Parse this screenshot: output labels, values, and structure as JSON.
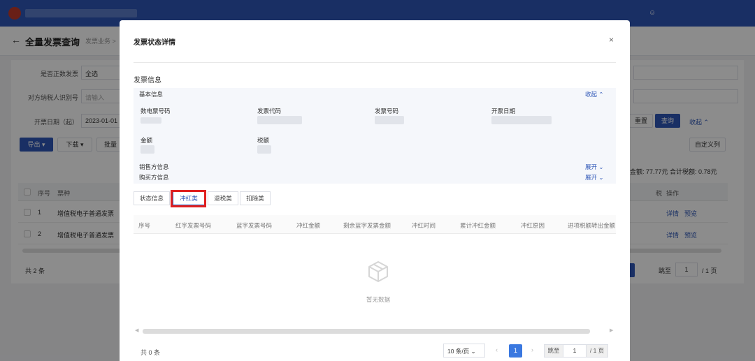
{
  "background": {
    "page_title": "全量发票查询",
    "breadcrumb": "发票业务 >",
    "filters": {
      "is_normal_label": "是否正数发票",
      "is_normal_value": "全选",
      "counterparty_label": "对方纳税人识别号",
      "counterparty_placeholder": "请输入",
      "date_label": "开票日期（起）",
      "date_value": "2023-01-01"
    },
    "buttons": {
      "export": "导出 ▾",
      "download": "下载 ▾",
      "batch": "批量",
      "reset": "重置",
      "query": "查询",
      "collapse": "收起 ⌃",
      "custom_columns": "自定义列"
    },
    "summary": "金额: 77.77元   合计税额: 0.78元",
    "table_headers": [
      "序号",
      "票种",
      "税",
      "操作"
    ],
    "rows": [
      {
        "index": "1",
        "type": "增值税电子普通发票",
        "action1": "详情",
        "action2": "预览"
      },
      {
        "index": "2",
        "type": "增值税电子普通发票",
        "action1": "详情",
        "action2": "预览"
      }
    ],
    "total": "共 2 条",
    "pager": {
      "jump_label": "跳至",
      "jump_value": "1",
      "total_pages": "/ 1 页"
    }
  },
  "modal": {
    "title": "发票状态详情",
    "close": "×",
    "section_title": "发票信息",
    "basic_info": {
      "heading": "基本信息",
      "collapse": "收起 ⌃",
      "labels": {
        "digital_number": "数电票号码",
        "invoice_code": "发票代码",
        "invoice_number": "发票号码",
        "issue_date": "开票日期",
        "amount": "金额",
        "tax": "税额"
      },
      "seller_heading": "销售方信息",
      "seller_expand": "展开 ⌄",
      "buyer_heading": "购买方信息",
      "buyer_expand": "展开 ⌄"
    },
    "tabs": [
      "状态信息",
      "冲红类",
      "退税类",
      "扣除类"
    ],
    "active_tab": 1,
    "table_headers": [
      "序号",
      "红字发票号码",
      "蓝字发票号码",
      "冲红金额",
      "剩余蓝字发票金额",
      "冲红时间",
      "累计冲红金额",
      "冲红原因",
      "进项税额转出金额"
    ],
    "empty_text": "暂无数据",
    "total": "共 0 条",
    "pagination": {
      "page_size": "10 条/页 ⌄",
      "prev": "‹",
      "current": "1",
      "next": "›",
      "jump_label": "跳至",
      "jump_value": "1",
      "total_pages": "/ 1 页"
    }
  },
  "colors": {
    "brand": "#2f57b7",
    "highlight": "#e02020",
    "page_active": "#3a78e0"
  }
}
